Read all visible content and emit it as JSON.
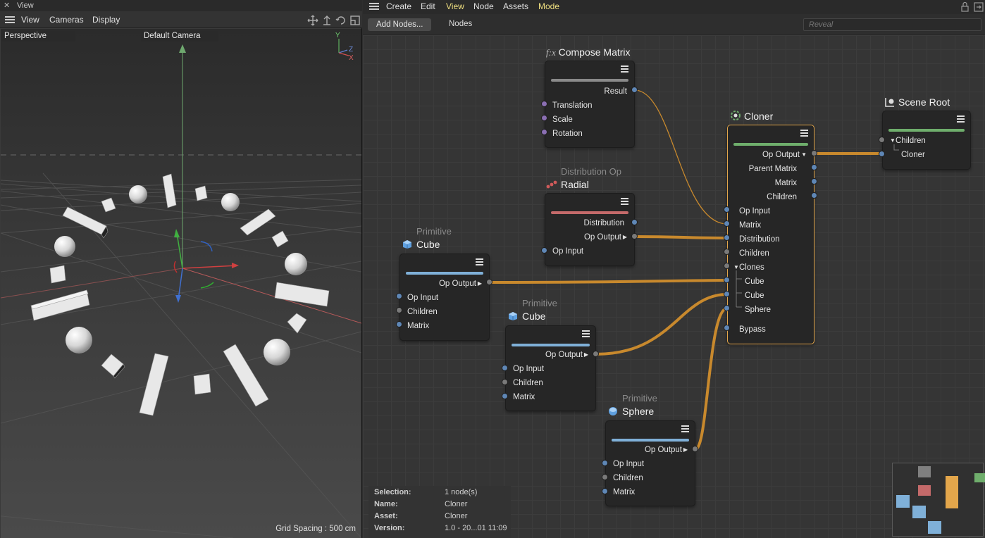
{
  "left_panel": {
    "title": "View",
    "menu": [
      "View",
      "Cameras",
      "Display"
    ],
    "projection": "Perspective",
    "camera": "Default Camera",
    "grid_spacing": "Grid Spacing : 500 cm",
    "axis_labels": {
      "y": "Y",
      "z": "Z",
      "x": "X"
    }
  },
  "node_editor": {
    "menu": [
      "Create",
      "Edit",
      "View",
      "Node",
      "Assets",
      "Mode"
    ],
    "active_menus": [
      "View",
      "Mode"
    ],
    "add_nodes_label": "Add Nodes...",
    "nodes_tab_label": "Nodes",
    "search_placeholder": "Reveal",
    "nodes": {
      "compose_matrix": {
        "title": "Compose Matrix",
        "icon_glyph": "f:x",
        "output": "Result",
        "inputs": [
          "Translation",
          "Scale",
          "Rotation"
        ]
      },
      "radial": {
        "subtitle": "Distribution Op",
        "title": "Radial",
        "outputs": [
          "Distribution",
          "Op Output"
        ],
        "inputs": [
          "Op Input"
        ]
      },
      "cube1": {
        "subtitle": "Primitive",
        "title": "Cube",
        "output": "Op Output",
        "inputs": [
          "Op Input",
          "Children",
          "Matrix"
        ]
      },
      "cube2": {
        "subtitle": "Primitive",
        "title": "Cube",
        "output": "Op Output",
        "inputs": [
          "Op Input",
          "Children",
          "Matrix"
        ]
      },
      "sphere": {
        "subtitle": "Primitive",
        "title": "Sphere",
        "output": "Op Output",
        "inputs": [
          "Op Input",
          "Children",
          "Matrix"
        ]
      },
      "cloner": {
        "title": "Cloner",
        "outputs": [
          "Op Output",
          "Parent Matrix",
          "Matrix",
          "Children"
        ],
        "inputs": [
          "Op Input",
          "Matrix",
          "Distribution",
          "Children",
          "Clones",
          "Cube",
          "Cube",
          "Sphere",
          "Bypass"
        ]
      },
      "scene_root": {
        "title": "Scene Root",
        "ports": [
          "Children",
          "Cloner"
        ]
      }
    },
    "info": {
      "labels": [
        "Selection:",
        "Name:",
        "Asset:",
        "Version:"
      ],
      "values": [
        "1 node(s)",
        "Cloner",
        "Cloner",
        "1.0 - 20...01 11:09"
      ]
    },
    "colors": {
      "accent_wire": "#c8892d",
      "selected_border": "#e3a64b",
      "green_bar": "#6fae6c",
      "blue_bar": "#7fb0d8",
      "red_bar": "#c46a6a"
    }
  }
}
